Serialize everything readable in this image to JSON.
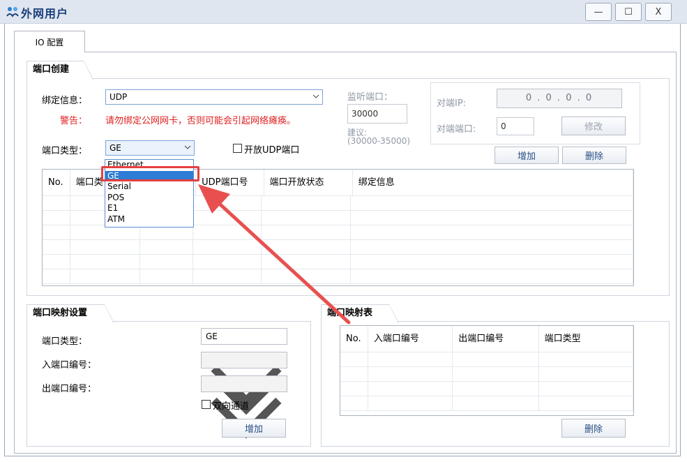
{
  "window": {
    "title": "外网用户",
    "buttons": {
      "minimize": "—",
      "maximize": "☐",
      "close": "X"
    }
  },
  "tabs": [
    {
      "label": "IO 配置"
    }
  ],
  "port_create": {
    "title": "端口创建",
    "bind_label": "绑定信息：",
    "bind_value": "UDP",
    "warn_label": "警告：",
    "warn_text": "请勿绑定公网网卡，否则可能会引起网络瘫痪。",
    "listen_label": "监听端口：",
    "listen_value": "30000",
    "suggest_label": "建议:",
    "suggest_range": "(30000-35000)",
    "peer_ip_label": "对端IP:",
    "peer_ip_value": "0 . 0 . 0 . 0",
    "peer_port_label": "对端端口:",
    "peer_port_value": "0",
    "modify_button": "修改",
    "port_type_label": "端口类型：",
    "port_type_value": "GE",
    "open_udp_label": "开放UDP端口",
    "add_button": "增加",
    "delete_button": "删除",
    "dropdown_options": [
      "Ethernet",
      "GE",
      "Serial",
      "POS",
      "E1",
      "ATM"
    ],
    "dropdown_selected": "GE",
    "table_headers": [
      "No.",
      "端口类",
      "UDP端口号",
      "端口开放状态",
      "绑定信息"
    ]
  },
  "port_mapping_settings": {
    "title": "端口映射设置",
    "port_type_label": "端口类型：",
    "port_type_value": "GE",
    "in_port_label": "入端口编号：",
    "out_port_label": "出端口编号：",
    "bidirectional_label": "双向通道",
    "add_button": "增加"
  },
  "port_mapping_table": {
    "title": "端口映射表",
    "headers": [
      "No.",
      "入端口编号",
      "出端口编号",
      "端口类型"
    ],
    "delete_button": "删除"
  },
  "colors": {
    "accent": "#2d7cd6",
    "warning": "#e02020",
    "highlight": "#e44040",
    "title": "#1a3f7a"
  }
}
